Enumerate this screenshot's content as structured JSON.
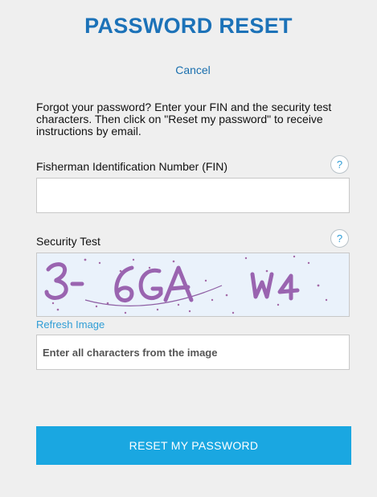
{
  "header": {
    "title": "PASSWORD RESET"
  },
  "nav": {
    "cancel_label": "Cancel"
  },
  "intro": {
    "text": "Forgot your password? Enter your FIN and the security test characters. Then click on \"Reset my password\" to receive instructions by email."
  },
  "fin": {
    "label": "Fisherman Identification Number (FIN)",
    "help_label": "?",
    "value": "",
    "placeholder": ""
  },
  "security": {
    "label": "Security Test",
    "help_label": "?",
    "captcha_text": "3 6GA W4",
    "refresh_label": "Refresh Image",
    "input_value": "",
    "input_placeholder": "Enter all characters from the image"
  },
  "actions": {
    "submit_label": "RESET MY PASSWORD"
  },
  "colors": {
    "background": "#efefef",
    "title": "#1c72b8",
    "link": "#1a6fae",
    "accent": "#1aa7e1",
    "captcha_bg": "#eaf2fb",
    "captcha_ink": "#9a64b0"
  }
}
